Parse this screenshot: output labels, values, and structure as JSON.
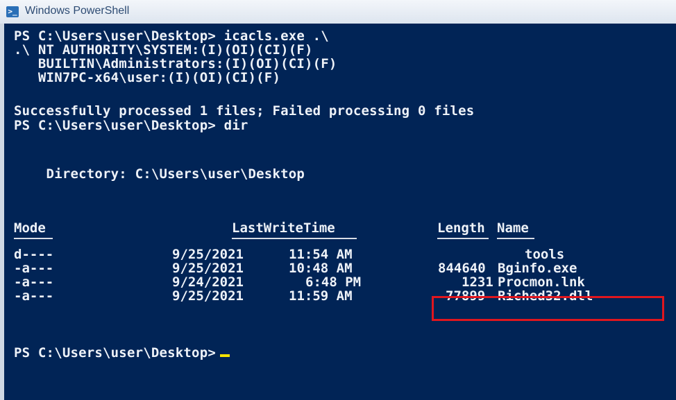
{
  "window": {
    "title": "Windows PowerShell",
    "icon": "powershell-icon"
  },
  "console": {
    "lines": {
      "cmd1": "PS C:\\Users\\user\\Desktop> icacls.exe .\\",
      "acl1": ".\\ NT AUTHORITY\\SYSTEM:(I)(OI)(CI)(F)",
      "acl2": "   BUILTIN\\Administrators:(I)(OI)(CI)(F)",
      "acl3": "   WIN7PC-x64\\user:(I)(OI)(CI)(F)",
      "status": "Successfully processed 1 files; Failed processing 0 files",
      "cmd2": "PS C:\\Users\\user\\Desktop> dir",
      "directory": "    Directory: C:\\Users\\user\\Desktop",
      "prompt": "PS C:\\Users\\user\\Desktop>"
    },
    "table": {
      "headers": {
        "mode": "Mode",
        "lastwritetime": "LastWriteTime",
        "length": "Length",
        "name": "Name"
      },
      "rows": [
        {
          "mode": "d----",
          "date": "9/25/2021",
          "time": "11:54 AM",
          "length": "",
          "name": "tools"
        },
        {
          "mode": "-a---",
          "date": "9/25/2021",
          "time": "10:48 AM",
          "length": "844640",
          "name": "Bginfo.exe"
        },
        {
          "mode": "-a---",
          "date": "9/24/2021",
          "time": "6:48 PM",
          "length": "1231",
          "name": "Procmon.lnk"
        },
        {
          "mode": "-a---",
          "date": "9/25/2021",
          "time": "11:59 AM",
          "length": "77899",
          "name": "Riched32.dll"
        }
      ]
    },
    "highlight_color": "#e0161e",
    "background_color": "#012456",
    "cursor_color": "#f5e300"
  }
}
